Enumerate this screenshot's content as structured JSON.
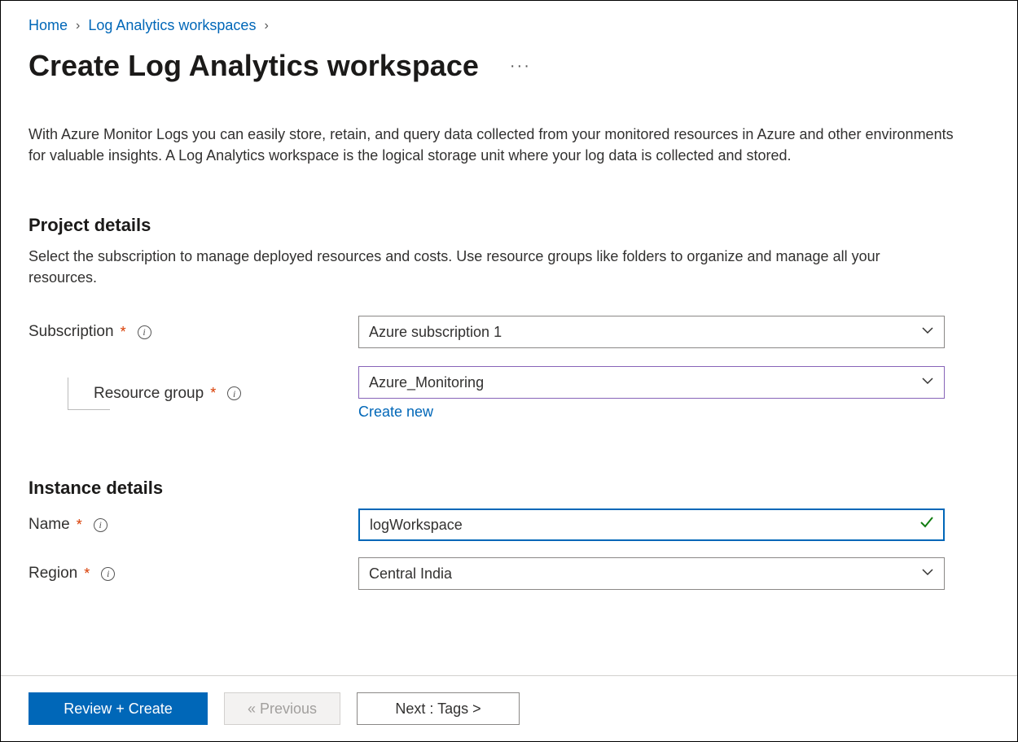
{
  "breadcrumb": {
    "home": "Home",
    "workspaces": "Log Analytics workspaces"
  },
  "title": "Create Log Analytics workspace",
  "intro": "With Azure Monitor Logs you can easily store, retain, and query data collected from your monitored resources in Azure and other environments for valuable insights. A Log Analytics workspace is the logical storage unit where your log data is collected and stored.",
  "project": {
    "heading": "Project details",
    "subtext": "Select the subscription to manage deployed resources and costs. Use resource groups like folders to organize and manage all your resources.",
    "subscription_label": "Subscription",
    "subscription_value": "Azure subscription 1",
    "rg_label": "Resource group",
    "rg_value": "Azure_Monitoring",
    "create_new": "Create new"
  },
  "instance": {
    "heading": "Instance details",
    "name_label": "Name",
    "name_value": "logWorkspace",
    "region_label": "Region",
    "region_value": "Central India"
  },
  "footer": {
    "review": "Review + Create",
    "previous": "« Previous",
    "next": "Next : Tags >"
  }
}
